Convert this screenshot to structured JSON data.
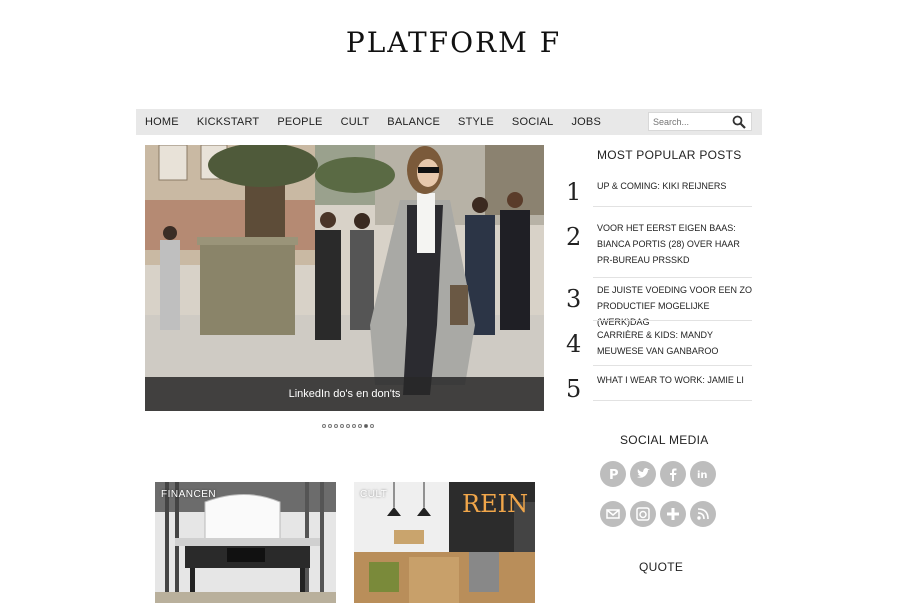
{
  "site": {
    "title": "PLATFORM F"
  },
  "nav": {
    "items": [
      "HOME",
      "KICKSTART",
      "PEOPLE",
      "CULT",
      "BALANCE",
      "STYLE",
      "SOCIAL",
      "JOBS"
    ],
    "search_placeholder": "Search...",
    "search_icon": "search-icon"
  },
  "slider": {
    "caption": "LinkedIn do's en don'ts",
    "dot_count": 9,
    "active_dot": 7
  },
  "cards": [
    {
      "label": "FINANCEN"
    },
    {
      "label": "CULT",
      "sign": "REIN"
    }
  ],
  "sidebar": {
    "popular_heading": "MOST POPULAR POSTS",
    "popular": [
      {
        "num": "1",
        "text": "UP & COMING: KIKI REIJNERS"
      },
      {
        "num": "2",
        "text": "VOOR HET EERST EIGEN BAAS: BIANCA PORTIS (28) OVER HAAR PR-BUREAU PRSSKD"
      },
      {
        "num": "3",
        "text": "DE JUISTE VOEDING VOOR EEN ZO PRODUCTIEF MOGELIJKE (WERK)DAG"
      },
      {
        "num": "4",
        "text": "CARRIÈRE & KIDS: MANDY MEUWESE VAN GANBAROO"
      },
      {
        "num": "5",
        "text": "WHAT I WEAR TO WORK: JAMIE LI"
      }
    ],
    "social_heading": "SOCIAL MEDIA",
    "social_icons": [
      "pinterest-icon",
      "twitter-icon",
      "facebook-icon",
      "linkedin-icon",
      "email-icon",
      "instagram-icon",
      "google-plus-icon",
      "rss-icon"
    ],
    "quote_heading": "QUOTE"
  }
}
